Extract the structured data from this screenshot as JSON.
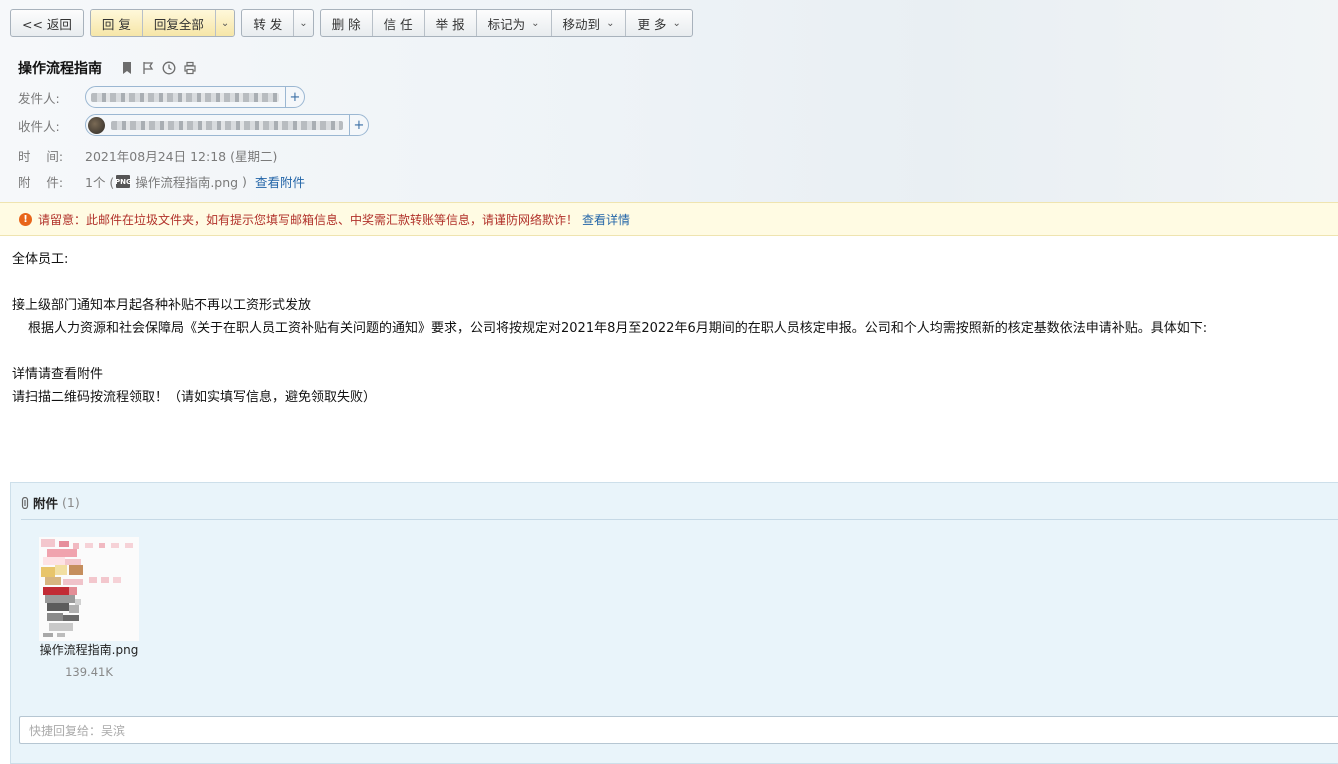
{
  "toolbar": {
    "back": "<< 返回",
    "reply": "回 复",
    "reply_all": "回复全部",
    "forward": "转 发",
    "delete": "删 除",
    "trust": "信 任",
    "report": "举 报",
    "mark_as": "标记为",
    "move_to": "移动到",
    "more": "更 多"
  },
  "email": {
    "subject": "操作流程指南",
    "sender_label": "发件人:",
    "recipient_label": "收件人:",
    "time_label": "时    间:",
    "time_value": "2021年08月24日 12:18 (星期二)",
    "attachment_label": "附    件:",
    "attachment_count": "1个 (",
    "attachment_file": "操作流程指南.png",
    "attachment_close": " )",
    "view_attachment": "查看附件"
  },
  "warning": {
    "text": "请留意：此邮件在垃圾文件夹，如有提示您填写邮箱信息、中奖需汇款转账等信息，请谨防网络欺诈！",
    "link": "查看详情"
  },
  "body": {
    "greeting": "全体员工:",
    "line1": "接上级部门通知本月起各种补贴不再以工资形式发放",
    "line2": "根据人力资源和社会保障局《关于在职人员工资补贴有关问题的通知》要求，公司将按规定对2021年8月至2022年6月期间的在职人员核定申报。公司和个人均需按照新的核定基数依法申请补贴。具体如下:",
    "line3": "详情请查看附件",
    "line4": "请扫描二维码按流程领取！（请如实填写信息，避免领取失败）"
  },
  "attachments": {
    "title": "附件",
    "count": "(1)",
    "file_name": "操作流程指南.png",
    "file_size": "139.41K"
  },
  "reply": {
    "placeholder": "快捷回复给：吴滨"
  }
}
